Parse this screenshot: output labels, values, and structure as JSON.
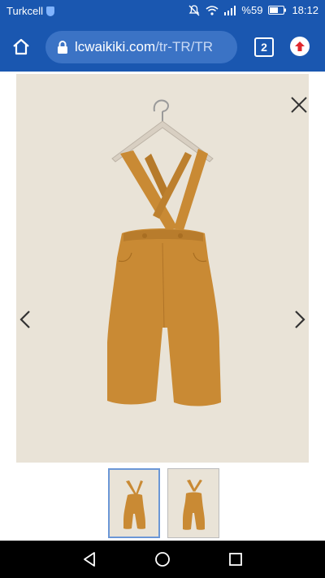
{
  "status_bar": {
    "carrier": "Turkcell",
    "battery": "%59",
    "time": "18:12"
  },
  "browser": {
    "url_host": "lcwaikiki.com",
    "url_path": "/tr-TR/TR",
    "tab_count": "2"
  },
  "gallery": {
    "thumbnail_count": 2,
    "selected_thumbnail": 1
  },
  "colors": {
    "browser_bar": "#1a57b0",
    "product_background": "#e9e3d7",
    "product": "#c98a34"
  },
  "icons": [
    "shield-icon",
    "mute-icon",
    "wifi-icon",
    "signal-icon",
    "battery-icon",
    "home-icon",
    "lock-icon",
    "update-icon",
    "close-icon",
    "chevron-left-icon",
    "chevron-right-icon",
    "back-icon",
    "home-circle-icon",
    "recents-icon"
  ]
}
